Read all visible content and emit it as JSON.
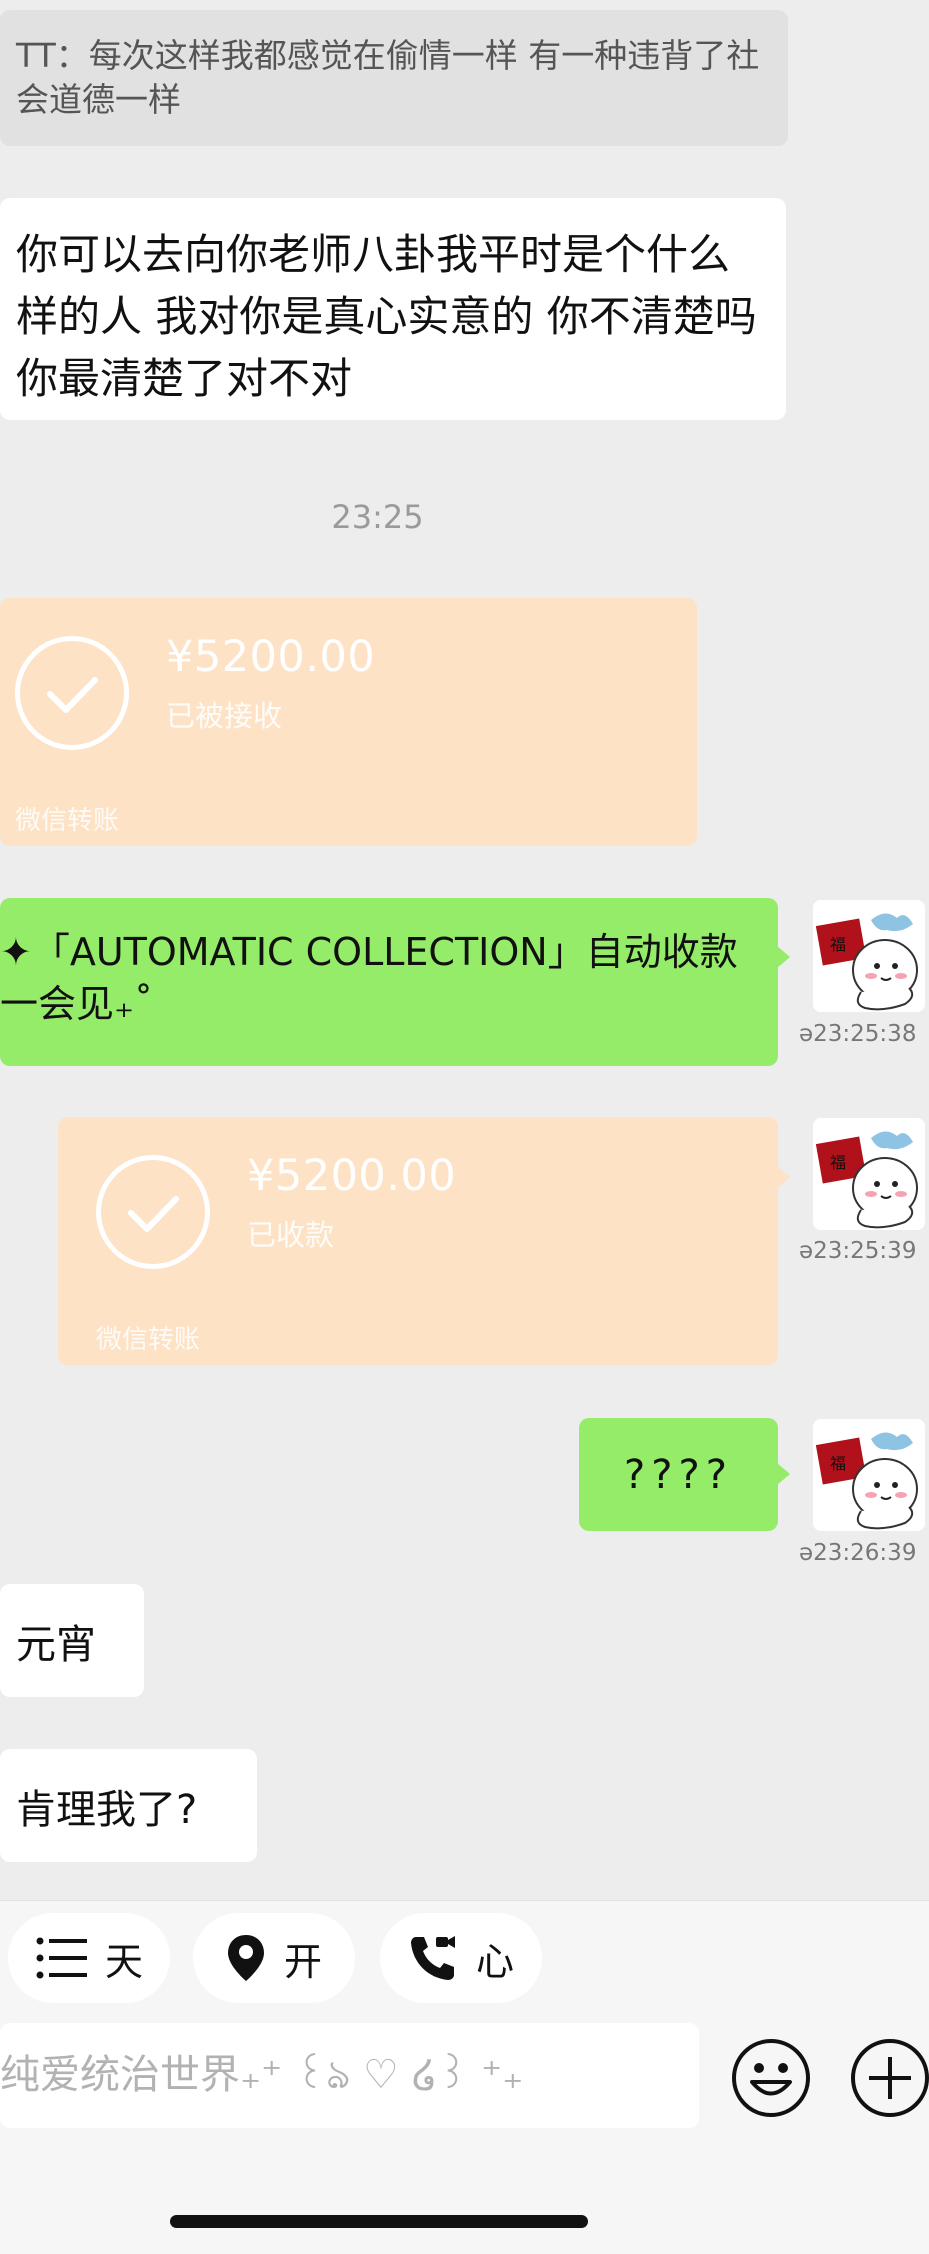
{
  "messages": {
    "quoted": "TT：每次这样我都感觉在偷情一样 有一种违背了社会道德一样",
    "incoming_long": "你可以去向你老师八卦我平时是个什么样的人 我对你是真心实意的 你不清楚吗 你最清楚了对不对",
    "time_divider": "23:25",
    "transfer_in": {
      "amount": "¥5200.00",
      "status": "已被接收",
      "footer": "微信转账"
    },
    "auto_collection": {
      "line1": "✦「AUTOMATIC COLLECTION」自动收款",
      "line2": "一会见₊˚"
    },
    "transfer_out": {
      "amount": "¥5200.00",
      "status": "已收款",
      "footer": "微信转账"
    },
    "question": "????",
    "yuanxiao": "元宵",
    "kenglime": "肯理我了?"
  },
  "side_times": {
    "t1": "ə23:25:38",
    "t2": "ə23:25:39",
    "t3": "ə23:26:39"
  },
  "quick_actions": {
    "days": "天",
    "location": "开",
    "call": "心"
  },
  "input": {
    "placeholder": "纯爱统治世界₊⁺ ꒰ঌ ♡ ໒꒱ ⁺₊"
  },
  "colors": {
    "background": "#ededed",
    "green_bubble": "#95ec69",
    "transfer_bubble": "#fde2c6"
  }
}
